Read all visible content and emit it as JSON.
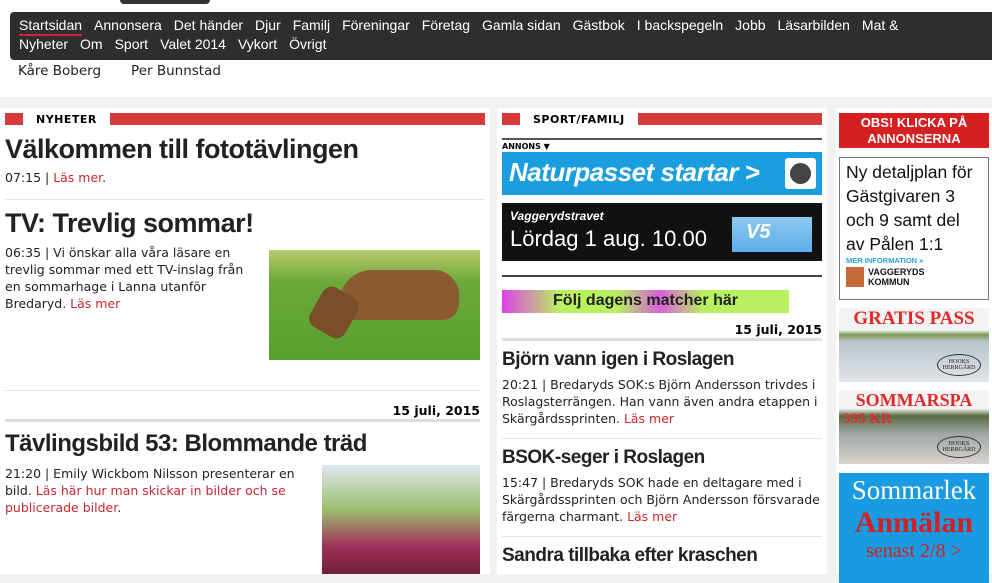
{
  "nav": {
    "row1": [
      "Startsidan",
      "Annonsera",
      "Det händer",
      "Djur",
      "Familj",
      "Föreningar",
      "Företag",
      "Gamla sidan",
      "Gästbok",
      "I backspegeln",
      "Jobb",
      "Läsarbilden",
      "Mat &"
    ],
    "row2": [
      "Nyheter",
      "Om",
      "Sport",
      "Valet 2014",
      "Vykort",
      "Övrigt"
    ],
    "sub": [
      "Kåre Boberg",
      "Per Bunnstad"
    ]
  },
  "left": {
    "section": "NYHETER",
    "a1": {
      "title": "Välkommen till fototävlingen",
      "time": "07:15 | ",
      "more": "Läs mer",
      "end": "."
    },
    "a2": {
      "title": "TV: Trevlig sommar!",
      "text": "06:35 | Vi önskar alla våra läsare en trevlig sommar med ett TV-inslag från en sommarhage i Lanna utanför Bredaryd. ",
      "more": "Läs mer"
    },
    "date": "15 juli, 2015",
    "a3": {
      "title": "Tävlingsbild 53: Blommande träd",
      "text": "21:20 | Emily Wickbom Nilsson presenterar en bild. ",
      "more": "Läs här hur man skickar in bilder och se publicerade bilder",
      "end": "."
    }
  },
  "mid": {
    "section": "SPORT/FAMILJ",
    "annons": "ANNONS ▼",
    "ad1": "Naturpasset startar >",
    "ad2a": "Vaggerydstravet",
    "ad2b": "Lördag 1 aug. 10.00",
    "ad2c": "V5",
    "ad3": "Följ dagens matcher här",
    "date": "15 juli, 2015",
    "a1": {
      "title": "Björn vann igen i Roslagen",
      "text": "20:21 | Bredaryds SOK:s Björn Andersson trivdes i Roslagsterrängen. Han vann även andra etappen i Skärgårdssprinten. ",
      "more": "Läs mer"
    },
    "a2": {
      "title": "BSOK-seger i Roslagen",
      "text": "15:47 | Bredaryds SOK hade en deltagare med i Skärgårdssprinten och Björn Andersson försvarade färgerna charmant. ",
      "more": "Läs mer"
    },
    "a3": {
      "title": "Sandra tillbaka efter kraschen"
    }
  },
  "right": {
    "obs": "OBS! KLICKA PÅ ANNONSERNA",
    "plan": "Ny detaljplan för Gästgivaren 3 och 9 samt del av Pålen 1:1",
    "info": "MER INFORMATION »",
    "kommun": "VAGGERYDS KOMMUN",
    "gratis": "GRATIS PASS",
    "hooks": "HOOKS HERRGÅRD",
    "spa": "SOMMARSPA",
    "price": "395 KR",
    "lek1": "Sommarlek",
    "lek2": "Anmälan",
    "lek3": "senast 2/8  >"
  }
}
